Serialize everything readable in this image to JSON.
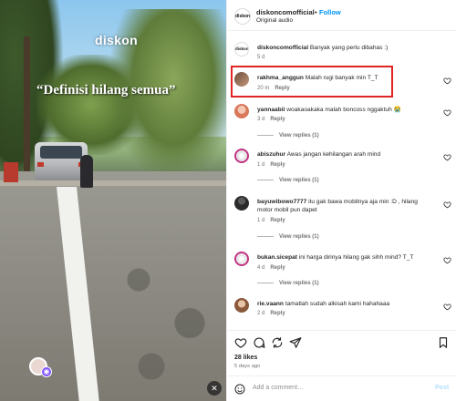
{
  "video": {
    "watermark": "diskon",
    "caption": "“Definisi hilang semua”",
    "mute_icon": "speaker-muted-icon"
  },
  "header": {
    "logo_text": "diskon",
    "username": "diskoncomofficial",
    "separator": "•",
    "follow_label": "Follow",
    "audio": "Original audio"
  },
  "caption_comment": {
    "username": "diskoncomofficial",
    "text": "Banyak yang perlu dibahas :)",
    "time": "5 d"
  },
  "comments": [
    {
      "username": "rakhma_anggun",
      "text": "Malah rugi banyak min T_T",
      "time": "20 m",
      "reply": "Reply",
      "view_replies": ""
    },
    {
      "username": "yannaabii",
      "text": "woakaoakaka malah boncoss nggaktuh 😭",
      "time": "3 d",
      "reply": "Reply",
      "view_replies": "View replies (1)"
    },
    {
      "username": "abiszuhur",
      "text": "Awas jangan kehilangan arah mind",
      "time": "1 d",
      "reply": "Reply",
      "view_replies": "View replies (1)"
    },
    {
      "username": "bayuwibowo7777",
      "text": "itu gak bawa mobilnya aja min :D , hilang motor mobil pun dapet",
      "time": "1 d",
      "reply": "Reply",
      "view_replies": "View replies (1)"
    },
    {
      "username": "bukan.sicepat",
      "text": "ini harga dirinya hilang gak sihh mind? T_T",
      "time": "4 d",
      "reply": "Reply",
      "view_replies": "View replies (1)"
    },
    {
      "username": "rie.vaann",
      "text": "tamatlah sudah alkisah kami hahahaaa",
      "time": "2 d",
      "reply": "Reply",
      "view_replies": ""
    }
  ],
  "actions": {
    "icons": [
      "heart-icon",
      "comment-icon",
      "share-icon",
      "send-icon",
      "bookmark-icon"
    ]
  },
  "likes": "28 likes",
  "posted": "5 days ago",
  "composer": {
    "placeholder": "Add a comment…",
    "post_label": "Post"
  },
  "colors": {
    "link_blue": "#0095f6",
    "highlight_red": "#e02424",
    "muted_text": "#737373"
  }
}
